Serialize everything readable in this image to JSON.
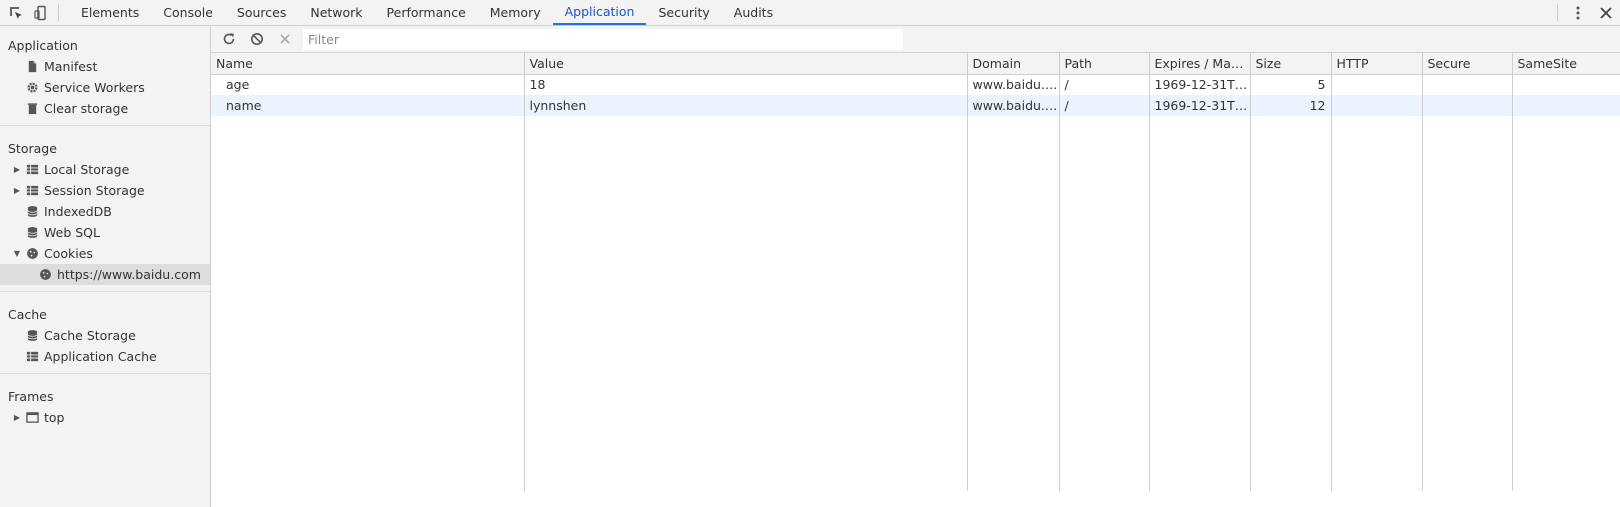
{
  "toolbar": {
    "tabs": [
      "Elements",
      "Console",
      "Sources",
      "Network",
      "Performance",
      "Memory",
      "Application",
      "Security",
      "Audits"
    ],
    "active_tab": "Application",
    "accent_color": "#1a73e8"
  },
  "sidebar": {
    "application": {
      "title": "Application",
      "items": [
        {
          "label": "Manifest",
          "icon": "file-icon"
        },
        {
          "label": "Service Workers",
          "icon": "gear-icon"
        },
        {
          "label": "Clear storage",
          "icon": "trash-icon"
        }
      ]
    },
    "storage": {
      "title": "Storage",
      "items": [
        {
          "label": "Local Storage",
          "icon": "table-icon"
        },
        {
          "label": "Session Storage",
          "icon": "table-icon"
        },
        {
          "label": "IndexedDB",
          "icon": "database-icon"
        },
        {
          "label": "Web SQL",
          "icon": "database-icon"
        },
        {
          "label": "Cookies",
          "icon": "cookie-icon"
        },
        {
          "label": "https://www.baidu.com",
          "icon": "cookie-icon"
        }
      ]
    },
    "cache": {
      "title": "Cache",
      "items": [
        {
          "label": "Cache Storage",
          "icon": "database-icon"
        },
        {
          "label": "Application Cache",
          "icon": "table-icon"
        }
      ]
    },
    "frames": {
      "title": "Frames",
      "items": [
        {
          "label": "top",
          "icon": "frame-icon"
        }
      ]
    }
  },
  "filter": {
    "placeholder": "Filter"
  },
  "table": {
    "columns": [
      "Name",
      "Value",
      "Domain",
      "Path",
      "Expires / Max-...",
      "Size",
      "HTTP",
      "Secure",
      "SameSite"
    ],
    "rows": [
      {
        "name": "age",
        "value": "18",
        "domain": "www.baidu.c...",
        "path": "/",
        "expires": "1969-12-31T2...",
        "size": "5",
        "http": "",
        "secure": "",
        "samesite": ""
      },
      {
        "name": "name",
        "value": "lynnshen",
        "domain": "www.baidu.c...",
        "path": "/",
        "expires": "1969-12-31T2...",
        "size": "12",
        "http": "",
        "secure": "",
        "samesite": ""
      }
    ]
  }
}
